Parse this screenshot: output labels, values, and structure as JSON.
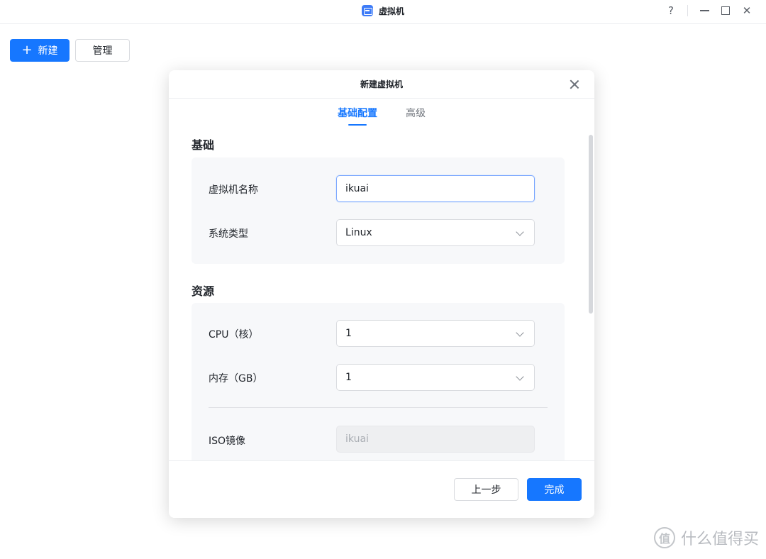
{
  "window": {
    "title": "虚拟机",
    "help": "?",
    "close": "✕"
  },
  "toolbar": {
    "new_label": "新建",
    "manage_label": "管理"
  },
  "modal": {
    "title": "新建虚拟机",
    "tabs": [
      {
        "label": "基础配置",
        "active": true
      },
      {
        "label": "高级",
        "active": false
      }
    ],
    "basic": {
      "section_title": "基础",
      "name_label": "虚拟机名称",
      "name_value": "ikuai",
      "os_label": "系统类型",
      "os_value": "Linux"
    },
    "resources": {
      "section_title": "资源",
      "cpu_label": "CPU（核）",
      "cpu_value": "1",
      "memory_label": "内存（GB）",
      "memory_value": "1",
      "iso_label": "ISO镜像",
      "iso_placeholder": "ikuai"
    },
    "footer": {
      "prev_label": "上一步",
      "done_label": "完成"
    }
  },
  "watermark": {
    "logo": "值",
    "text": "什么值得买"
  },
  "colors": {
    "accent": "#1677ff",
    "panel_bg": "#f7f8fa"
  }
}
